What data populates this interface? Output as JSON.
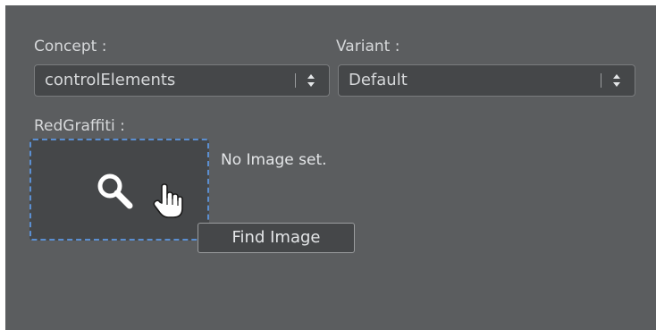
{
  "concept": {
    "label": "Concept :",
    "value": "controlElements"
  },
  "variant": {
    "label": "Variant :",
    "value": "Default"
  },
  "image_field": {
    "label": "RedGraffiti :",
    "status": "No Image set.",
    "tooltip": "Find Image"
  },
  "icons": {
    "select_arrows": "up-down-arrows-icon",
    "search": "magnifier-icon",
    "cursor": "hand-pointer-icon"
  },
  "colors": {
    "panel": "#5b5d5f",
    "field": "#454749",
    "dashed_border": "#5b8fd1",
    "text": "#d6d8da"
  }
}
